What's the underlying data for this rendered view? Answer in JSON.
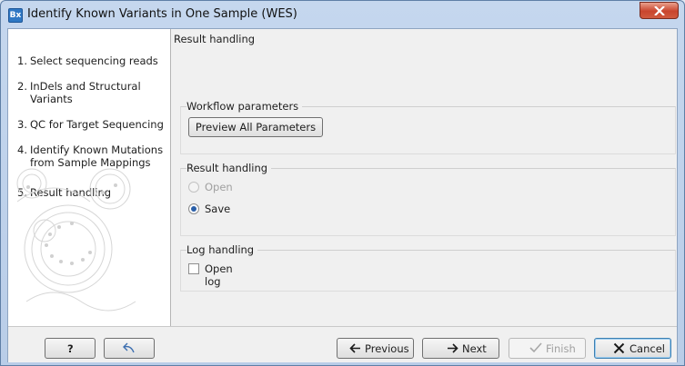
{
  "window": {
    "app_icon_text": "Bx",
    "title": "Identify Known Variants in One Sample (WES)"
  },
  "steps": [
    {
      "num": "1.",
      "label": "Select sequencing reads"
    },
    {
      "num": "2.",
      "label": "InDels and Structural Variants"
    },
    {
      "num": "3.",
      "label": "QC for Target Sequencing"
    },
    {
      "num": "4.",
      "label": "Identify Known Mutations from Sample Mappings"
    },
    {
      "num": "5.",
      "label": "Result handling"
    }
  ],
  "content": {
    "title": "Result handling",
    "workflow_group": {
      "label": "Workflow parameters",
      "preview_button": "Preview All Parameters"
    },
    "result_group": {
      "label": "Result handling",
      "options": [
        {
          "label": "Open",
          "selected": false,
          "enabled": false
        },
        {
          "label": "Save",
          "selected": true,
          "enabled": true
        }
      ]
    },
    "log_group": {
      "label": "Log handling",
      "checkbox_label": "Open log",
      "checked": false
    }
  },
  "footer": {
    "help_label": "?",
    "previous_label": "Previous",
    "next_label": "Next",
    "finish_label": "Finish",
    "cancel_label": "Cancel"
  },
  "colors": {
    "accent": "#2f78c4",
    "close_red": "#c9452d",
    "next_arrow": "#1a1a1a",
    "cancel_x": "#1a1a1a"
  }
}
